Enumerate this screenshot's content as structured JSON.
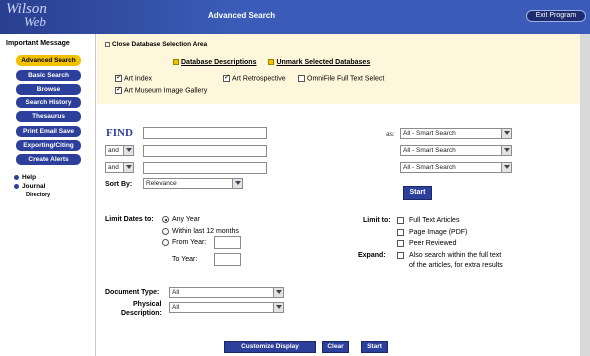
{
  "header": {
    "logo_line1": "Wilson",
    "logo_line2": "Web",
    "title": "Advanced Search",
    "exit_label": "Exit Program"
  },
  "sidebar": {
    "heading": "Important Message",
    "buttons": [
      {
        "label": "Advanced Search",
        "active": true
      },
      {
        "label": "Basic Search"
      },
      {
        "label": "Browse"
      },
      {
        "label": "Search History"
      },
      {
        "label": "Thesaurus"
      },
      {
        "label": "Print Email Save"
      },
      {
        "label": "Exporting/Citing"
      },
      {
        "label": "Create Alerts"
      }
    ],
    "links": [
      {
        "label": "Help"
      },
      {
        "label": "Journal",
        "sub": "Directory"
      }
    ]
  },
  "databases": {
    "close_label": "Close Database Selection Area",
    "descriptions_label": "Database Descriptions",
    "unmark_label": "Unmark Selected Databases",
    "items": [
      {
        "label": "Art Index",
        "checked": true
      },
      {
        "label": "Art Retrospective",
        "checked": true
      },
      {
        "label": "OmniFile Full Text Select",
        "checked": false
      },
      {
        "label": "Art Museum Image Gallery",
        "checked": true
      }
    ]
  },
  "search": {
    "find_label": "FIND",
    "as_label": "as:",
    "rows": [
      {
        "op": "",
        "field": "All - Smart Search"
      },
      {
        "op": "and",
        "field": "All - Smart Search"
      },
      {
        "op": "and",
        "field": "All - Smart Search"
      }
    ],
    "sort_label": "Sort By:",
    "sort_value": "Relevance",
    "start_label": "Start"
  },
  "limit_dates": {
    "label": "Limit Dates to:",
    "options": [
      "Any Year",
      "Within last 12 months",
      "From Year:"
    ],
    "to_year_label": "To Year:"
  },
  "limit_to": {
    "label": "Limit to:",
    "options": [
      "Full Text Articles",
      "Page Image (PDF)",
      "Peer Reviewed"
    ]
  },
  "expand": {
    "label": "Expand:",
    "line1": "Also search within the full text",
    "line2": "of the articles, for extra results"
  },
  "document_type": {
    "label": "Document Type:",
    "value": "All"
  },
  "physical_description": {
    "label_line1": "Physical",
    "label_line2": "Description:",
    "value": "All"
  },
  "bottom": {
    "customize_label": "Customize Display",
    "clear_label": "Clear",
    "start_label": "Start"
  },
  "colors": {
    "header_blue": "#3a5cb8",
    "button_blue": "#2b3f9b",
    "active_yellow": "#f2c200",
    "db_area_bg": "#fff7dc"
  }
}
